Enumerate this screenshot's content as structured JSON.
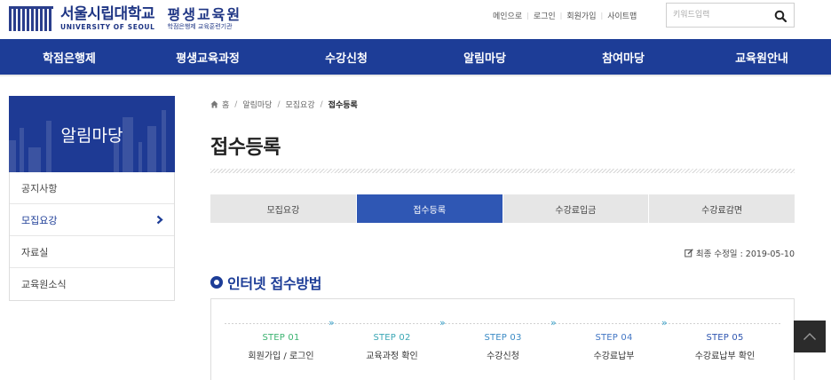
{
  "logo": {
    "name_kr": "서울시립대학교",
    "name_en": "UNIVERSITY OF SEOUL",
    "institute": "평생교육원",
    "institute_desc": "학점은행제 교육훈련기관"
  },
  "util_links": [
    "메인으로",
    "로그인",
    "회원가입",
    "사이트맵"
  ],
  "search": {
    "placeholder": "키워드입력"
  },
  "gnb": [
    "학점은행제",
    "평생교육과정",
    "수강신청",
    "알림마당",
    "참여마당",
    "교육원안내"
  ],
  "sidebar": {
    "title": "알림마당",
    "items": [
      {
        "label": "공지사항",
        "active": false
      },
      {
        "label": "모집요강",
        "active": true
      },
      {
        "label": "자료실",
        "active": false
      },
      {
        "label": "교육원소식",
        "active": false
      }
    ]
  },
  "breadcrumb": [
    "홈",
    "알림마당",
    "모집요강",
    "접수등록"
  ],
  "page_title": "접수등록",
  "tabs": [
    {
      "label": "모집요강",
      "active": false
    },
    {
      "label": "접수등록",
      "active": true
    },
    {
      "label": "수강료입금",
      "active": false
    },
    {
      "label": "수강료감면",
      "active": false
    }
  ],
  "updated": "최종 수정일 : 2019-05-10",
  "section_title": "인터넷 접수방법",
  "steps": [
    {
      "num": "STEP 01",
      "label": "회원가입 / 로그인",
      "color": "#3cb371"
    },
    {
      "num": "STEP 02",
      "label": "교육과정 확인",
      "color": "#3ba7b5"
    },
    {
      "num": "STEP 03",
      "label": "수강신청",
      "color": "#3b8bc5"
    },
    {
      "num": "STEP 04",
      "label": "수강료납부",
      "color": "#4276c4"
    },
    {
      "num": "STEP 05",
      "label": "수강료납부 확인",
      "color": "#2f56b0"
    }
  ],
  "colors": {
    "primary": "#1d3d97",
    "tab_active": "#2f57b4",
    "topbtn": "#2b2b2b"
  }
}
